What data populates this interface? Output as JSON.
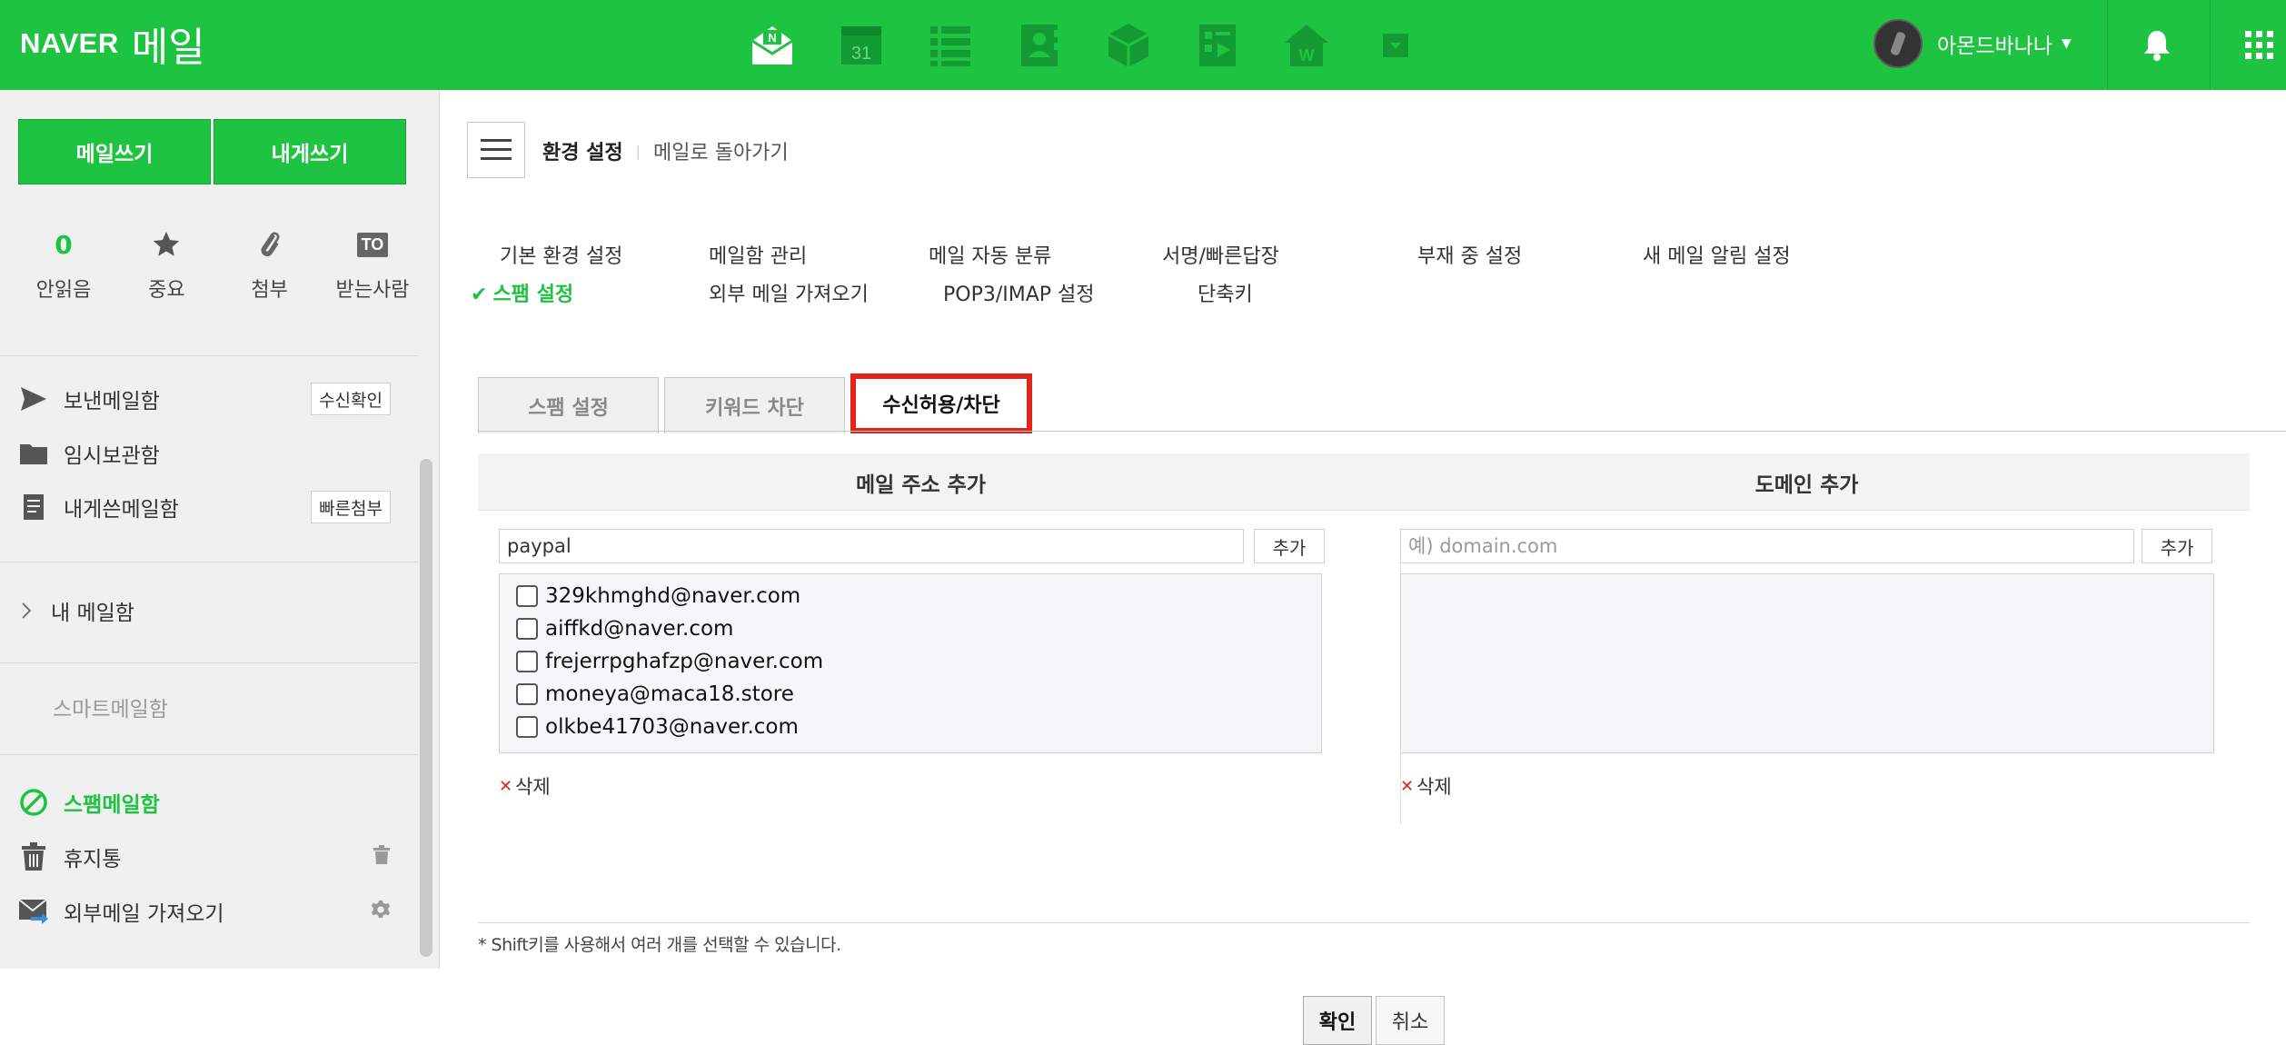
{
  "header": {
    "brand": "NAVER",
    "service": "메일",
    "user_name": "아몬드바나나",
    "apps": [
      "mail-app-icon",
      "calendar-app-icon",
      "list-app-icon",
      "contacts-app-icon",
      "box-app-icon",
      "memo-app-icon",
      "office-app-icon",
      "more-app-icon"
    ],
    "calendar_day": "31"
  },
  "sidebar": {
    "compose_label": "메일쓰기",
    "self_compose_label": "내게쓰기",
    "quick": [
      {
        "count": "0",
        "label": "안읽음"
      },
      {
        "label": "중요"
      },
      {
        "label": "첨부"
      },
      {
        "badge": "TO",
        "label": "받는사람"
      }
    ],
    "folders": {
      "sent": {
        "label": "보낸메일함",
        "button": "수신확인"
      },
      "drafts": {
        "label": "임시보관함"
      },
      "self": {
        "label": "내게쓴메일함",
        "button": "빠른첨부"
      },
      "my": {
        "label": "내 메일함"
      },
      "smart": {
        "label": "스마트메일함"
      },
      "spam": {
        "label": "스팸메일함"
      },
      "trash": {
        "label": "휴지통"
      },
      "external": {
        "label": "외부메일 가져오기"
      }
    }
  },
  "main": {
    "breadcrumb": {
      "current": "환경 설정",
      "back": "메일로 돌아가기"
    },
    "menu": {
      "row1": [
        "기본 환경 설정",
        "메일함 관리",
        "메일 자동 분류",
        "서명/빠른답장",
        "부재 중 설정",
        "새 메일 알림 설정"
      ],
      "row2": [
        "스팸 설정",
        "외부 메일 가져오기",
        "POP3/IMAP 설정",
        "단축키"
      ],
      "active_check": "✔"
    },
    "tabs": [
      "스팸 설정",
      "키워드 차단",
      "수신허용/차단"
    ],
    "email_section": {
      "title": "메일 주소 추가",
      "input_value": "paypal",
      "add_label": "추가",
      "items": [
        "329khmghd@naver.com",
        "aiffkd@naver.com",
        "frejerrpghafzp@naver.com",
        "moneya@maca18.store",
        "olkbe41703@naver.com"
      ],
      "delete_label": "삭제"
    },
    "domain_section": {
      "title": "도메인 추가",
      "placeholder": "예) domain.com",
      "add_label": "추가",
      "items": [],
      "delete_label": "삭제"
    },
    "note": "* Shift키를 사용해서 여러 개를 선택할 수 있습니다.",
    "confirm_label": "확인",
    "cancel_label": "취소"
  },
  "colors": {
    "brand_green": "#1ec341",
    "highlight_red": "#e3241b"
  }
}
